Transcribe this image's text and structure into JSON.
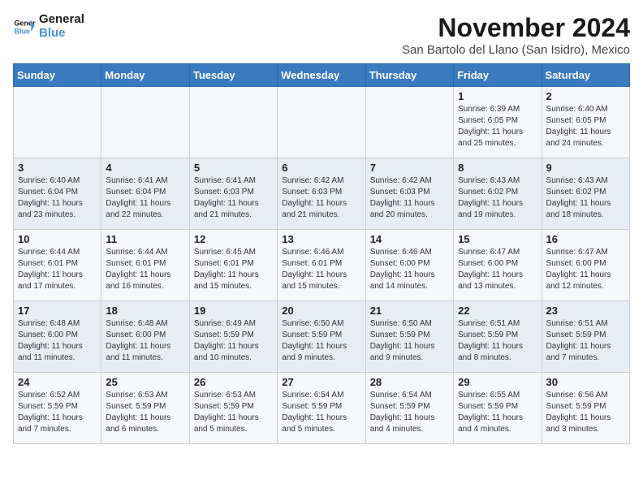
{
  "logo": {
    "line1": "General",
    "line2": "Blue"
  },
  "title": "November 2024",
  "subtitle": "San Bartolo del Llano (San Isidro), Mexico",
  "days_of_week": [
    "Sunday",
    "Monday",
    "Tuesday",
    "Wednesday",
    "Thursday",
    "Friday",
    "Saturday"
  ],
  "weeks": [
    [
      {
        "day": "",
        "info": ""
      },
      {
        "day": "",
        "info": ""
      },
      {
        "day": "",
        "info": ""
      },
      {
        "day": "",
        "info": ""
      },
      {
        "day": "",
        "info": ""
      },
      {
        "day": "1",
        "info": "Sunrise: 6:39 AM\nSunset: 6:05 PM\nDaylight: 11 hours\nand 25 minutes."
      },
      {
        "day": "2",
        "info": "Sunrise: 6:40 AM\nSunset: 6:05 PM\nDaylight: 11 hours\nand 24 minutes."
      }
    ],
    [
      {
        "day": "3",
        "info": "Sunrise: 6:40 AM\nSunset: 6:04 PM\nDaylight: 11 hours\nand 23 minutes."
      },
      {
        "day": "4",
        "info": "Sunrise: 6:41 AM\nSunset: 6:04 PM\nDaylight: 11 hours\nand 22 minutes."
      },
      {
        "day": "5",
        "info": "Sunrise: 6:41 AM\nSunset: 6:03 PM\nDaylight: 11 hours\nand 21 minutes."
      },
      {
        "day": "6",
        "info": "Sunrise: 6:42 AM\nSunset: 6:03 PM\nDaylight: 11 hours\nand 21 minutes."
      },
      {
        "day": "7",
        "info": "Sunrise: 6:42 AM\nSunset: 6:03 PM\nDaylight: 11 hours\nand 20 minutes."
      },
      {
        "day": "8",
        "info": "Sunrise: 6:43 AM\nSunset: 6:02 PM\nDaylight: 11 hours\nand 19 minutes."
      },
      {
        "day": "9",
        "info": "Sunrise: 6:43 AM\nSunset: 6:02 PM\nDaylight: 11 hours\nand 18 minutes."
      }
    ],
    [
      {
        "day": "10",
        "info": "Sunrise: 6:44 AM\nSunset: 6:01 PM\nDaylight: 11 hours\nand 17 minutes."
      },
      {
        "day": "11",
        "info": "Sunrise: 6:44 AM\nSunset: 6:01 PM\nDaylight: 11 hours\nand 16 minutes."
      },
      {
        "day": "12",
        "info": "Sunrise: 6:45 AM\nSunset: 6:01 PM\nDaylight: 11 hours\nand 15 minutes."
      },
      {
        "day": "13",
        "info": "Sunrise: 6:46 AM\nSunset: 6:01 PM\nDaylight: 11 hours\nand 15 minutes."
      },
      {
        "day": "14",
        "info": "Sunrise: 6:46 AM\nSunset: 6:00 PM\nDaylight: 11 hours\nand 14 minutes."
      },
      {
        "day": "15",
        "info": "Sunrise: 6:47 AM\nSunset: 6:00 PM\nDaylight: 11 hours\nand 13 minutes."
      },
      {
        "day": "16",
        "info": "Sunrise: 6:47 AM\nSunset: 6:00 PM\nDaylight: 11 hours\nand 12 minutes."
      }
    ],
    [
      {
        "day": "17",
        "info": "Sunrise: 6:48 AM\nSunset: 6:00 PM\nDaylight: 11 hours\nand 11 minutes."
      },
      {
        "day": "18",
        "info": "Sunrise: 6:48 AM\nSunset: 6:00 PM\nDaylight: 11 hours\nand 11 minutes."
      },
      {
        "day": "19",
        "info": "Sunrise: 6:49 AM\nSunset: 5:59 PM\nDaylight: 11 hours\nand 10 minutes."
      },
      {
        "day": "20",
        "info": "Sunrise: 6:50 AM\nSunset: 5:59 PM\nDaylight: 11 hours\nand 9 minutes."
      },
      {
        "day": "21",
        "info": "Sunrise: 6:50 AM\nSunset: 5:59 PM\nDaylight: 11 hours\nand 9 minutes."
      },
      {
        "day": "22",
        "info": "Sunrise: 6:51 AM\nSunset: 5:59 PM\nDaylight: 11 hours\nand 8 minutes."
      },
      {
        "day": "23",
        "info": "Sunrise: 6:51 AM\nSunset: 5:59 PM\nDaylight: 11 hours\nand 7 minutes."
      }
    ],
    [
      {
        "day": "24",
        "info": "Sunrise: 6:52 AM\nSunset: 5:59 PM\nDaylight: 11 hours\nand 7 minutes."
      },
      {
        "day": "25",
        "info": "Sunrise: 6:53 AM\nSunset: 5:59 PM\nDaylight: 11 hours\nand 6 minutes."
      },
      {
        "day": "26",
        "info": "Sunrise: 6:53 AM\nSunset: 5:59 PM\nDaylight: 11 hours\nand 5 minutes."
      },
      {
        "day": "27",
        "info": "Sunrise: 6:54 AM\nSunset: 5:59 PM\nDaylight: 11 hours\nand 5 minutes."
      },
      {
        "day": "28",
        "info": "Sunrise: 6:54 AM\nSunset: 5:59 PM\nDaylight: 11 hours\nand 4 minutes."
      },
      {
        "day": "29",
        "info": "Sunrise: 6:55 AM\nSunset: 5:59 PM\nDaylight: 11 hours\nand 4 minutes."
      },
      {
        "day": "30",
        "info": "Sunrise: 6:56 AM\nSunset: 5:59 PM\nDaylight: 11 hours\nand 3 minutes."
      }
    ]
  ]
}
